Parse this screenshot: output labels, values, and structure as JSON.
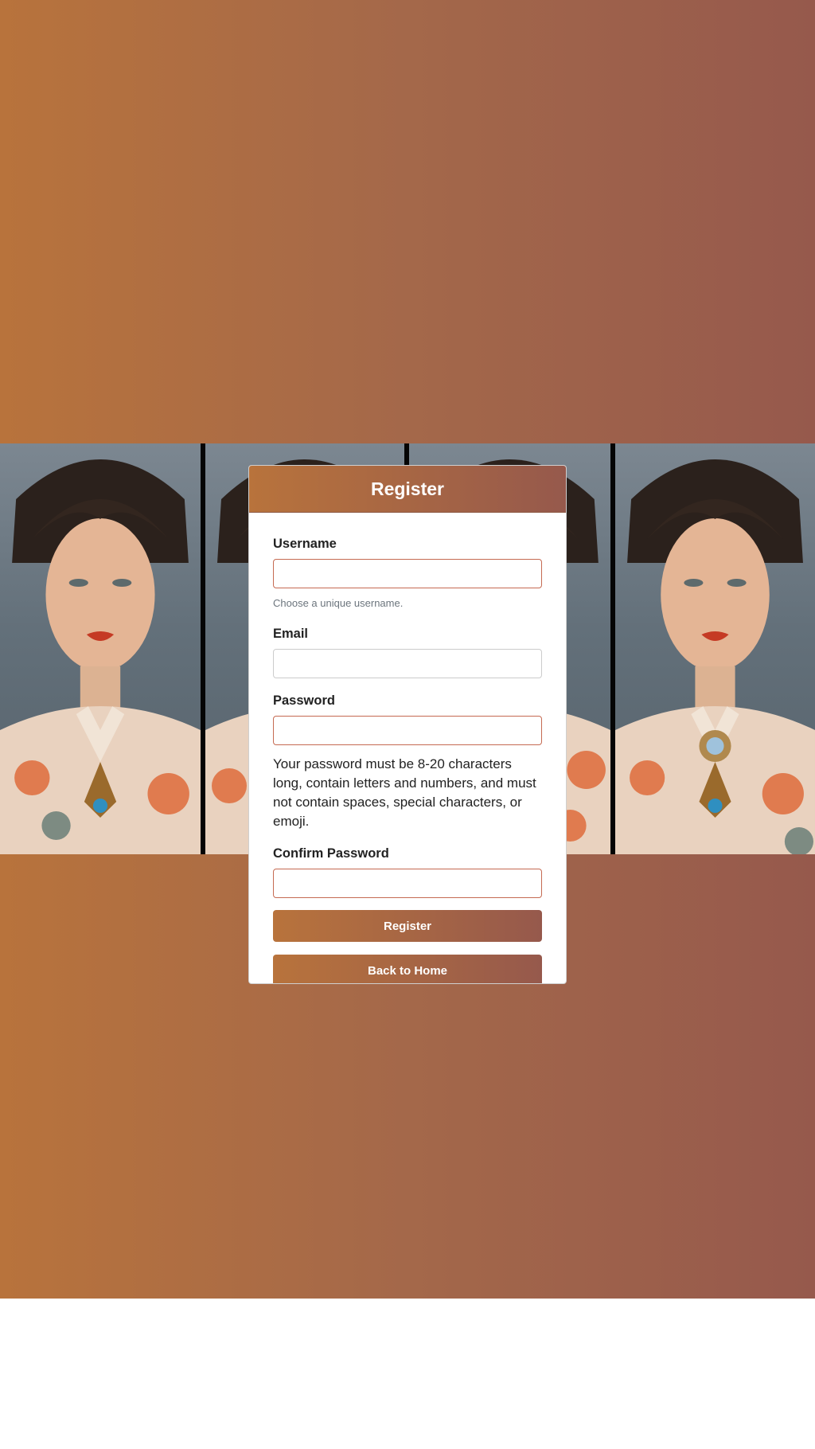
{
  "colors": {
    "gradient_start": "#b8733c",
    "gradient_end": "#96594c",
    "input_border_accent": "#c56a52",
    "hint_text": "#6c757d"
  },
  "background": {
    "image_semantic": "portrait-photo-strip",
    "panels": 4
  },
  "form": {
    "title": "Register",
    "fields": {
      "username": {
        "label": "Username",
        "value": "",
        "hint": "Choose a unique username."
      },
      "email": {
        "label": "Email",
        "value": ""
      },
      "password": {
        "label": "Password",
        "value": "",
        "help": "Your password must be 8-20 characters long, contain letters and numbers, and must not contain spaces, special characters, or emoji."
      },
      "confirm_password": {
        "label": "Confirm Password",
        "value": ""
      }
    },
    "buttons": {
      "register": "Register",
      "back_home": "Back to Home"
    }
  }
}
